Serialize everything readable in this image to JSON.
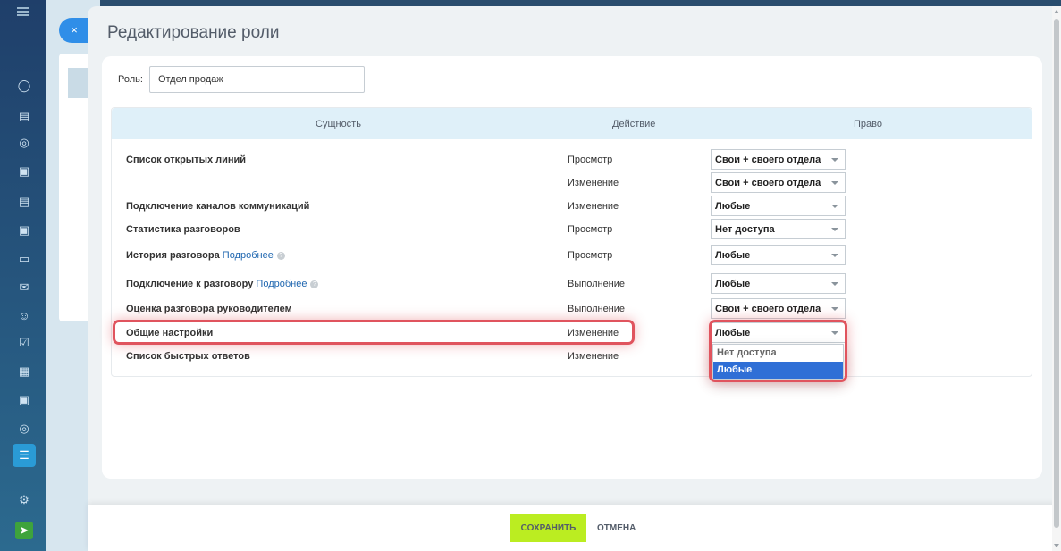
{
  "slider": {
    "title": "Редактирование роли",
    "close_icon": "×"
  },
  "role": {
    "label": "Роль:",
    "value": "Отдел продаж"
  },
  "table": {
    "headers": {
      "entity": "Сущность",
      "action": "Действие",
      "right": "Право"
    },
    "rows": [
      {
        "entity": "Список открытых линий",
        "more": "",
        "action": "Просмотр",
        "right": "Свои + своего отдела"
      },
      {
        "entity": "",
        "more": "",
        "action": "Изменение",
        "right": "Свои + своего отдела"
      },
      {
        "entity": "Подключение каналов коммуникаций",
        "more": "",
        "action": "Изменение",
        "right": "Любые"
      },
      {
        "entity": "Статистика разговоров",
        "more": "",
        "action": "Просмотр",
        "right": "Нет доступа"
      },
      {
        "entity": "История разговора",
        "more": "Подробнее",
        "action": "Просмотр",
        "right": "Любые"
      },
      {
        "entity": "Подключение к разговору",
        "more": "Подробнее",
        "action": "Выполнение",
        "right": "Любые"
      },
      {
        "entity": "Оценка разговора руководителем",
        "more": "",
        "action": "Выполнение",
        "right": "Свои + своего отдела"
      },
      {
        "entity": "Общие настройки",
        "more": "",
        "action": "Изменение",
        "right": "Любые"
      },
      {
        "entity": "Список быстрых ответов",
        "more": "",
        "action": "Изменение",
        "right": ""
      }
    ]
  },
  "dropdown": {
    "options": [
      "Нет доступа",
      "Любые"
    ],
    "selected": "Любые"
  },
  "footer": {
    "save_label": "СОХРАНИТЬ",
    "cancel_label": "ОТМЕНА"
  },
  "colors": {
    "save_bg": "#bbed21",
    "highlight": "#e0545e",
    "selected_option": "#2f6fd6",
    "header_bg": "#dff0f9"
  }
}
